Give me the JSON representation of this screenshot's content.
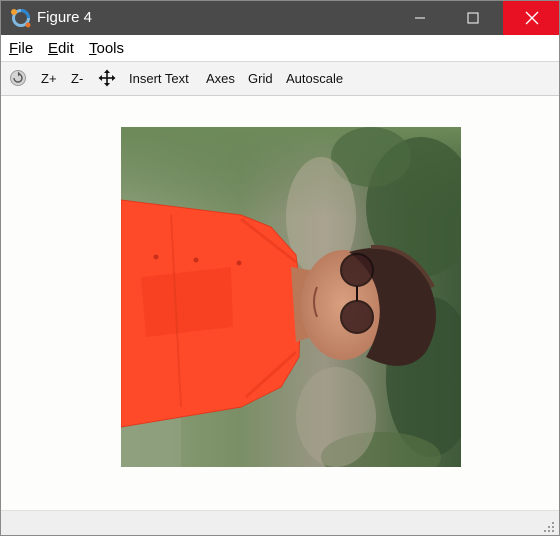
{
  "window": {
    "title": "Figure 4"
  },
  "menu": {
    "file": {
      "u": "F",
      "rest": "ile"
    },
    "edit": {
      "u": "E",
      "rest": "dit"
    },
    "tools": {
      "u": "T",
      "rest": "ools"
    }
  },
  "toolbar": {
    "zoom_in": "Z+",
    "zoom_out": "Z-",
    "insert_text": "Insert Text",
    "axes": "Axes",
    "grid": "Grid",
    "autoscale": "Autoscale"
  },
  "icons": {
    "app": "octave-logo-icon",
    "rotate": "rotate-icon",
    "pan": "pan-move-icon",
    "minimize": "minimize-icon",
    "maximize": "maximize-icon",
    "close": "close-icon",
    "resize": "resize-grip-icon"
  },
  "colors": {
    "titlebar": "#4a4a4a",
    "close_button": "#e81123",
    "shirt": "#ff4a2a",
    "background_green": "#6f8a5c"
  },
  "image": {
    "content": "rotated photo of a man in an orange shirt and sunglasses against a green outdoor background"
  }
}
